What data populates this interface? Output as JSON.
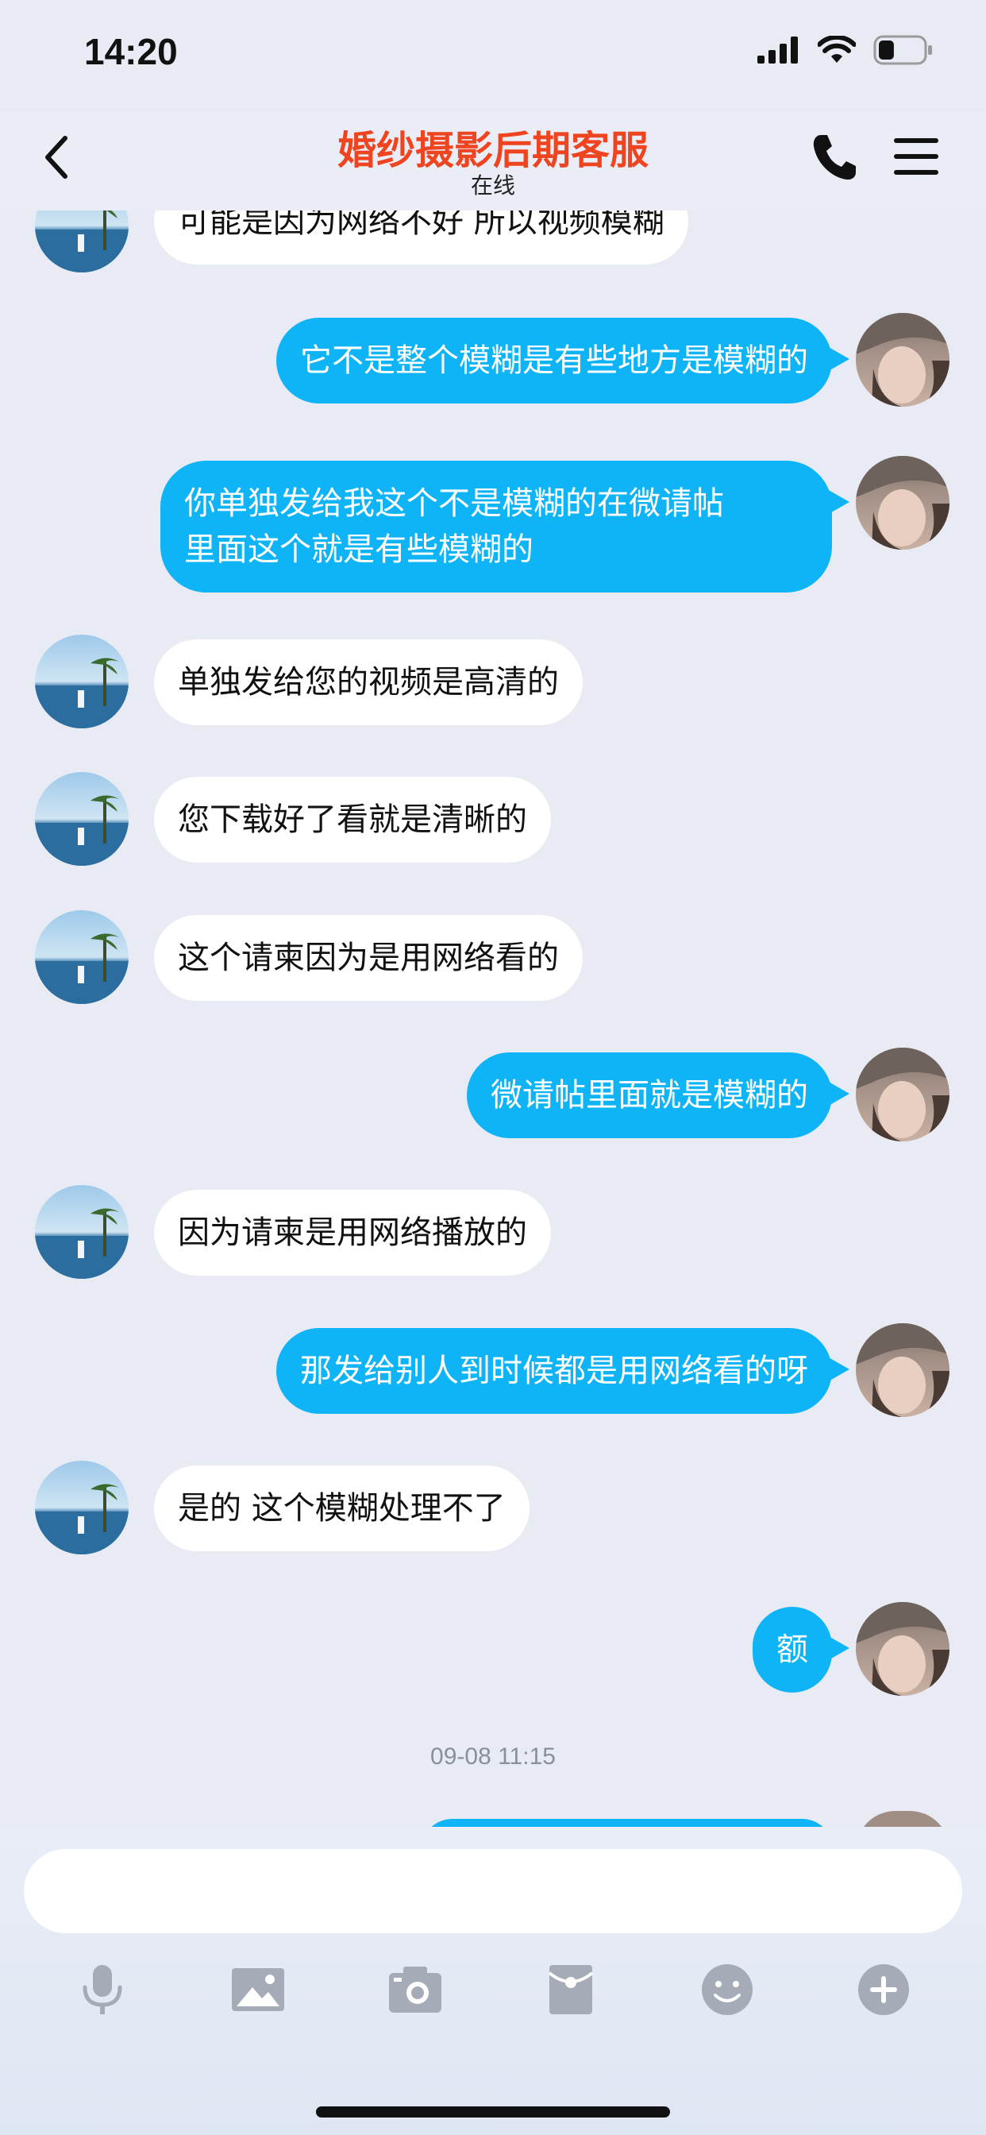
{
  "status": {
    "time": "14:20",
    "battery_level": 0.35
  },
  "header": {
    "title": "婚纱摄影后期客服",
    "subtitle": "在线",
    "title_color": "#ee4520"
  },
  "messages": [
    {
      "side": "left",
      "text": "可能是因为网络不好 所以视频模糊"
    },
    {
      "side": "right",
      "text": "它不是整个模糊是有些地方是模糊的"
    },
    {
      "side": "right",
      "lines": [
        "你单独发给我这个不是模糊的在微请帖",
        "里面这个就是有些模糊的"
      ]
    },
    {
      "side": "left",
      "text": "单独发给您的视频是高清的"
    },
    {
      "side": "left",
      "text": "您下载好了看就是清晰的"
    },
    {
      "side": "left",
      "text": "这个请柬因为是用网络看的"
    },
    {
      "side": "right",
      "text": "微请帖里面就是模糊的"
    },
    {
      "side": "left",
      "text": "因为请柬是用网络播放的"
    },
    {
      "side": "right",
      "text": "那发给别人到时候都是用网络看的呀"
    },
    {
      "side": "left",
      "text": "是的 这个模糊处理不了"
    },
    {
      "side": "right",
      "text": "额"
    }
  ],
  "timestamp": "09-08 11:15",
  "composer": {
    "input_value": "",
    "tools": [
      "microphone-icon",
      "image-icon",
      "camera-icon",
      "red-packet-icon",
      "emoji-icon",
      "plus-icon"
    ]
  },
  "colors": {
    "sent_bubble": "#0fb4f6",
    "received_bubble": "#ffffff",
    "background": "#e8ebf4",
    "icon_gray": "#a5abb7"
  }
}
